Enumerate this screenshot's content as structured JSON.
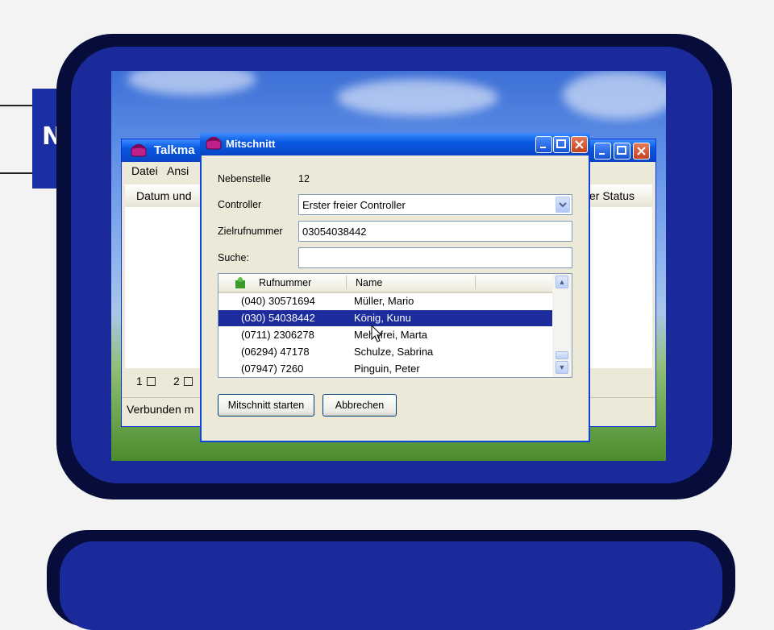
{
  "side_tab": {
    "letter": "N"
  },
  "background_window": {
    "title": "Talkma",
    "menu": [
      "Datei",
      "Ansi"
    ],
    "header_left": "Datum und",
    "header_right": "er Status",
    "tray": [
      "1",
      "2"
    ],
    "status": "Verbunden m"
  },
  "dialog": {
    "title": "Mitschnitt",
    "nebenstelle": {
      "label": "Nebenstelle",
      "value": "12"
    },
    "controller": {
      "label": "Controller",
      "value": "Erster freier Controller"
    },
    "zielrufnummer": {
      "label": "Zielrufnummer",
      "value": "03054038442"
    },
    "suche": {
      "label": "Suche:",
      "value": ""
    },
    "list": {
      "columns": [
        "Rufnummer",
        "Name"
      ],
      "rows": [
        {
          "number": "(040) 30571694",
          "name": "Müller, Mario",
          "selected": false
        },
        {
          "number": "(030) 54038442",
          "name": "König, Kunu",
          "selected": true
        },
        {
          "number": "(0711) 2306278",
          "name": "Mehnfrei, Marta",
          "selected": false
        },
        {
          "number": "(06294) 47178",
          "name": "Schulze, Sabrina",
          "selected": false
        },
        {
          "number": "(07947) 7260",
          "name": "Pinguin, Peter",
          "selected": false
        }
      ]
    },
    "buttons": {
      "start": "Mitschnitt starten",
      "cancel": "Abbrechen"
    }
  }
}
